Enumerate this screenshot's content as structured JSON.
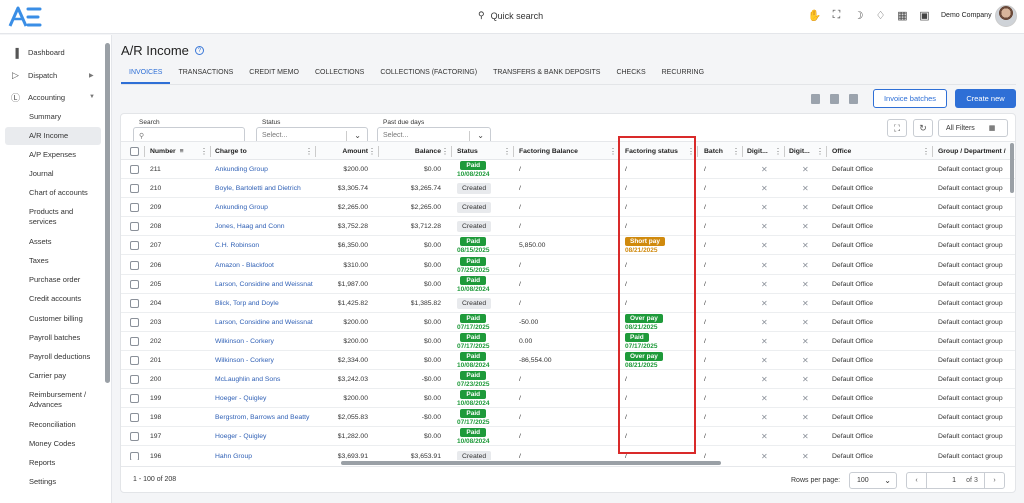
{
  "header": {
    "quick_search": "Quick search",
    "company": "Demo Company",
    "icons": [
      "hand-icon",
      "expand-icon",
      "moon-icon",
      "bell-icon",
      "apps-icon",
      "wallet-icon"
    ]
  },
  "sidebar": {
    "items": [
      {
        "label": "Dashboard",
        "icon": "chart-icon"
      },
      {
        "label": "Dispatch",
        "icon": "send-icon"
      },
      {
        "label": "Accounting",
        "icon": "dollar-icon"
      }
    ],
    "sub_items": [
      "Summary",
      "A/R Income",
      "A/P Expenses",
      "Journal",
      "Chart of accounts",
      "Products and services",
      "Assets",
      "Taxes",
      "Purchase order",
      "Credit accounts",
      "Customer billing",
      "Payroll batches",
      "Payroll deductions",
      "Carrier pay",
      "Reimbursement / Advances",
      "Reconciliation",
      "Money Codes",
      "Reports",
      "Settings"
    ],
    "active": "A/R Income"
  },
  "page": {
    "title": "A/R Income",
    "tabs": [
      "INVOICES",
      "TRANSACTIONS",
      "CREDIT MEMO",
      "COLLECTIONS",
      "COLLECTIONS (FACTORING)",
      "TRANSFERS & BANK DEPOSITS",
      "CHECKS",
      "RECURRING"
    ],
    "active_tab": "INVOICES",
    "invoice_batches": "Invoice batches",
    "create_new": "Create new"
  },
  "filters": {
    "search_label": "Search",
    "status_label": "Status",
    "status_placeholder": "Select...",
    "past_due_label": "Past due days",
    "past_due_placeholder": "Select...",
    "all_filters": "All Filters"
  },
  "columns": [
    "Number",
    "Charge to",
    "Amount",
    "Balance",
    "Status",
    "Factoring Balance",
    "Factoring status",
    "Batch",
    "Digit...",
    "Digit...",
    "Office",
    "Group / Department /"
  ],
  "rows": [
    {
      "number": "211",
      "charge_to": "Ankunding Group",
      "amount": "$200.00",
      "balance": "$0.00",
      "status": "Paid",
      "status_date": "10/08/2024",
      "factoring_balance": "/",
      "factoring_status": "/",
      "factoring_date": "",
      "batch": "/",
      "office": "Default Office",
      "group": "Default contact group"
    },
    {
      "number": "210",
      "charge_to": "Boyle, Bartoletti and Dietrich",
      "amount": "$3,305.74",
      "balance": "$3,265.74",
      "status": "Created",
      "status_date": "",
      "factoring_balance": "/",
      "factoring_status": "/",
      "factoring_date": "",
      "batch": "/",
      "office": "Default Office",
      "group": "Default contact group"
    },
    {
      "number": "209",
      "charge_to": "Ankunding Group",
      "amount": "$2,265.00",
      "balance": "$2,265.00",
      "status": "Created",
      "status_date": "",
      "factoring_balance": "/",
      "factoring_status": "/",
      "factoring_date": "",
      "batch": "/",
      "office": "Default Office",
      "group": "Default contact group"
    },
    {
      "number": "208",
      "charge_to": "Jones, Haag and Conn",
      "amount": "$3,752.28",
      "balance": "$3,712.28",
      "status": "Created",
      "status_date": "",
      "factoring_balance": "/",
      "factoring_status": "/",
      "factoring_date": "",
      "batch": "/",
      "office": "Default Office",
      "group": "Default contact group"
    },
    {
      "number": "207",
      "charge_to": "C.H. Robinson",
      "amount": "$6,350.00",
      "balance": "$0.00",
      "status": "Paid",
      "status_date": "08/15/2025",
      "factoring_balance": "5,850.00",
      "factoring_status": "Short pay",
      "factoring_date": "08/21/2025",
      "batch": "/",
      "office": "Default Office",
      "group": "Default contact group"
    },
    {
      "number": "206",
      "charge_to": "Amazon - Blackfoot",
      "amount": "$310.00",
      "balance": "$0.00",
      "status": "Paid",
      "status_date": "07/25/2025",
      "factoring_balance": "/",
      "factoring_status": "/",
      "factoring_date": "",
      "batch": "/",
      "office": "Default Office",
      "group": "Default contact group"
    },
    {
      "number": "205",
      "charge_to": "Larson, Considine and Weissnat",
      "amount": "$1,987.00",
      "balance": "$0.00",
      "status": "Paid",
      "status_date": "10/08/2024",
      "factoring_balance": "/",
      "factoring_status": "/",
      "factoring_date": "",
      "batch": "/",
      "office": "Default Office",
      "group": "Default contact group"
    },
    {
      "number": "204",
      "charge_to": "Blick, Torp and Doyle",
      "amount": "$1,425.82",
      "balance": "$1,385.82",
      "status": "Created",
      "status_date": "",
      "factoring_balance": "/",
      "factoring_status": "/",
      "factoring_date": "",
      "batch": "/",
      "office": "Default Office",
      "group": "Default contact group"
    },
    {
      "number": "203",
      "charge_to": "Larson, Considine and Weissnat",
      "amount": "$200.00",
      "balance": "$0.00",
      "status": "Paid",
      "status_date": "07/17/2025",
      "factoring_balance": "-50.00",
      "factoring_status": "Over pay",
      "factoring_date": "08/21/2025",
      "batch": "/",
      "office": "Default Office",
      "group": "Default contact group"
    },
    {
      "number": "202",
      "charge_to": "Wilkinson - Corkery",
      "amount": "$200.00",
      "balance": "$0.00",
      "status": "Paid",
      "status_date": "07/17/2025",
      "factoring_balance": "0.00",
      "factoring_status": "Paid",
      "factoring_date": "07/17/2025",
      "batch": "/",
      "office": "Default Office",
      "group": "Default contact group"
    },
    {
      "number": "201",
      "charge_to": "Wilkinson - Corkery",
      "amount": "$2,334.00",
      "balance": "$0.00",
      "status": "Paid",
      "status_date": "10/08/2024",
      "factoring_balance": "-86,554.00",
      "factoring_status": "Over pay",
      "factoring_date": "08/21/2025",
      "batch": "/",
      "office": "Default Office",
      "group": "Default contact group"
    },
    {
      "number": "200",
      "charge_to": "McLaughlin and Sons",
      "amount": "$3,242.03",
      "balance": "-$0.00",
      "status": "Paid",
      "status_date": "07/23/2025",
      "factoring_balance": "/",
      "factoring_status": "/",
      "factoring_date": "",
      "batch": "/",
      "office": "Default Office",
      "group": "Default contact group"
    },
    {
      "number": "199",
      "charge_to": "Hoeger - Quigley",
      "amount": "$200.00",
      "balance": "$0.00",
      "status": "Paid",
      "status_date": "10/08/2024",
      "factoring_balance": "/",
      "factoring_status": "/",
      "factoring_date": "",
      "batch": "/",
      "office": "Default Office",
      "group": "Default contact group"
    },
    {
      "number": "198",
      "charge_to": "Bergstrom, Barrows and Beatty",
      "amount": "$2,055.83",
      "balance": "-$0.00",
      "status": "Paid",
      "status_date": "07/17/2025",
      "factoring_balance": "/",
      "factoring_status": "/",
      "factoring_date": "",
      "batch": "/",
      "office": "Default Office",
      "group": "Default contact group"
    },
    {
      "number": "197",
      "charge_to": "Hoeger - Quigley",
      "amount": "$1,282.00",
      "balance": "$0.00",
      "status": "Paid",
      "status_date": "10/08/2024",
      "factoring_balance": "/",
      "factoring_status": "/",
      "factoring_date": "",
      "batch": "/",
      "office": "Default Office",
      "group": "Default contact group"
    },
    {
      "number": "196",
      "charge_to": "Hahn Group",
      "amount": "$3,693.91",
      "balance": "$3,653.91",
      "status": "Created",
      "status_date": "",
      "factoring_balance": "/",
      "factoring_status": "/",
      "factoring_date": "",
      "batch": "/",
      "office": "Default Office",
      "group": "Default contact group"
    }
  ],
  "footer": {
    "range": "1 - 100 of 208",
    "rows_per_page_label": "Rows per page:",
    "rows_per_page": "100",
    "page": "1",
    "of_pages": "of 3"
  },
  "colors": {
    "accent": "#2e6fd6",
    "paid": "#1e9a3a",
    "short_pay": "#d08a0e",
    "highlight": "#d92a2a"
  }
}
